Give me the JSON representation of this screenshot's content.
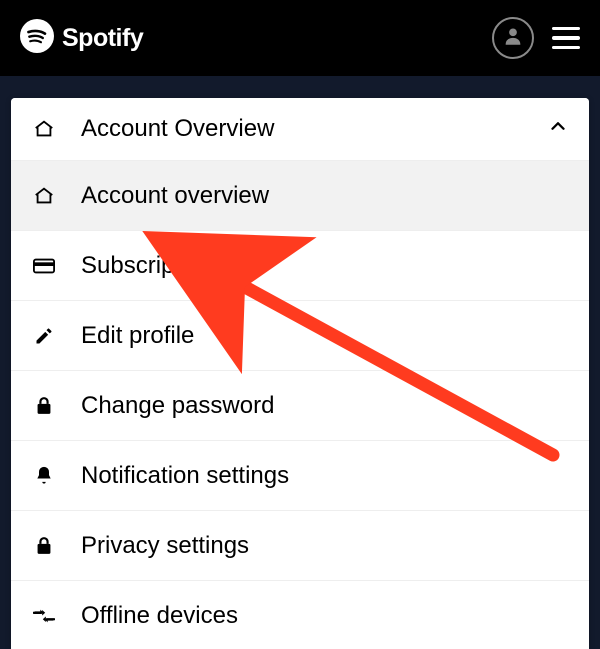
{
  "brand": {
    "name": "Spotify"
  },
  "menu": {
    "header": {
      "label": "Account Overview"
    },
    "items": [
      {
        "icon": "home-icon",
        "label": "Account overview",
        "active": true
      },
      {
        "icon": "card-icon",
        "label": "Subscription",
        "active": false
      },
      {
        "icon": "pencil-icon",
        "label": "Edit profile",
        "active": false
      },
      {
        "icon": "lock-icon",
        "label": "Change password",
        "active": false
      },
      {
        "icon": "bell-icon",
        "label": "Notification settings",
        "active": false
      },
      {
        "icon": "lock-icon",
        "label": "Privacy settings",
        "active": false
      },
      {
        "icon": "offline-icon",
        "label": "Offline devices",
        "active": false
      }
    ]
  },
  "annotation": {
    "arrow_color": "#ff3b1f"
  }
}
